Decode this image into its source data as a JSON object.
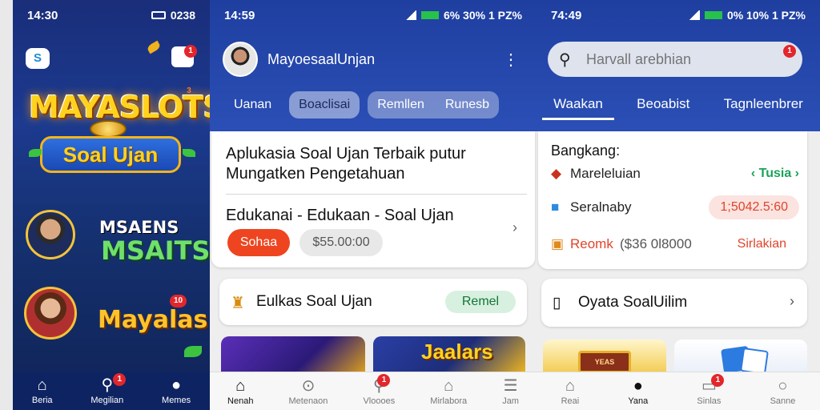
{
  "screen1": {
    "status": {
      "time": "14:30",
      "right": "0238"
    },
    "app_icon": "S",
    "badge_top": "1",
    "brand_title": "MAYASLOTS",
    "brand_badge": "3",
    "banner": "Soal Ujan",
    "label_line1": "MSAENS",
    "label_line2": "MSAITS",
    "label_line3": "Mayalas",
    "label_badge": "10",
    "nav": [
      {
        "icon": "home-icon",
        "label": "Beria"
      },
      {
        "icon": "search-icon",
        "label": "Megilian",
        "badge": "1"
      },
      {
        "icon": "profile-icon",
        "label": "Memes"
      }
    ]
  },
  "screen2": {
    "status": {
      "time": "14:59",
      "right": "6% 30% 1 PZ%"
    },
    "profile_name": "MayoesaalUnjan",
    "tabs": [
      "Uanan",
      "Boaclisai",
      "Remllen",
      "Runesb"
    ],
    "card": {
      "title": "Aplukasia Soal Ujan Terbaik putur Mungatken Pengetahuan",
      "subtitle": "Edukanai - Edukaan - Soal Ujan",
      "button_red": "Sohaa",
      "price": "$55.00:00"
    },
    "feature": {
      "label": "Eulkas Soal Ujan",
      "pill": "Remel"
    },
    "thumb_text": "Jaalars",
    "nav": [
      {
        "icon": "home-icon",
        "label": "Nenah",
        "active": true
      },
      {
        "icon": "download-icon",
        "label": "Metenaon"
      },
      {
        "icon": "search-icon",
        "label": "Vloooes",
        "badge": "1"
      },
      {
        "icon": "store-icon",
        "label": "Mirlabora"
      },
      {
        "icon": "menu-icon",
        "label": "Jam"
      }
    ]
  },
  "screen3": {
    "status": {
      "time": "74:49",
      "right": "0% 10% 1 PZ%"
    },
    "search_placeholder": "Harvall arebhian",
    "search_badge": "1",
    "tabs": [
      "Waakan",
      "Beoabist",
      "Tagnleenbrer"
    ],
    "card": {
      "heading": "Bangkang:",
      "rows": [
        {
          "icon": "cube-icon",
          "label": "Mareleluian",
          "tag": "Tusia"
        },
        {
          "icon": "box-icon",
          "label": "Seralnaby",
          "tag": "1;5042.5:60"
        },
        {
          "icon": "gift-icon",
          "label": "Reomk",
          "mid": "($36 0l8000",
          "action": "Sirlakian"
        }
      ]
    },
    "feature": {
      "label": "Oyata SoalUilim"
    },
    "sign_text": "YEAS",
    "nav": [
      {
        "icon": "home-icon",
        "label": "Reai"
      },
      {
        "icon": "user-icon",
        "label": "Yana",
        "active": true
      },
      {
        "icon": "inbox-icon",
        "label": "Sinlas",
        "badge": "1"
      },
      {
        "icon": "profile-icon",
        "label": "Sanne"
      }
    ]
  }
}
